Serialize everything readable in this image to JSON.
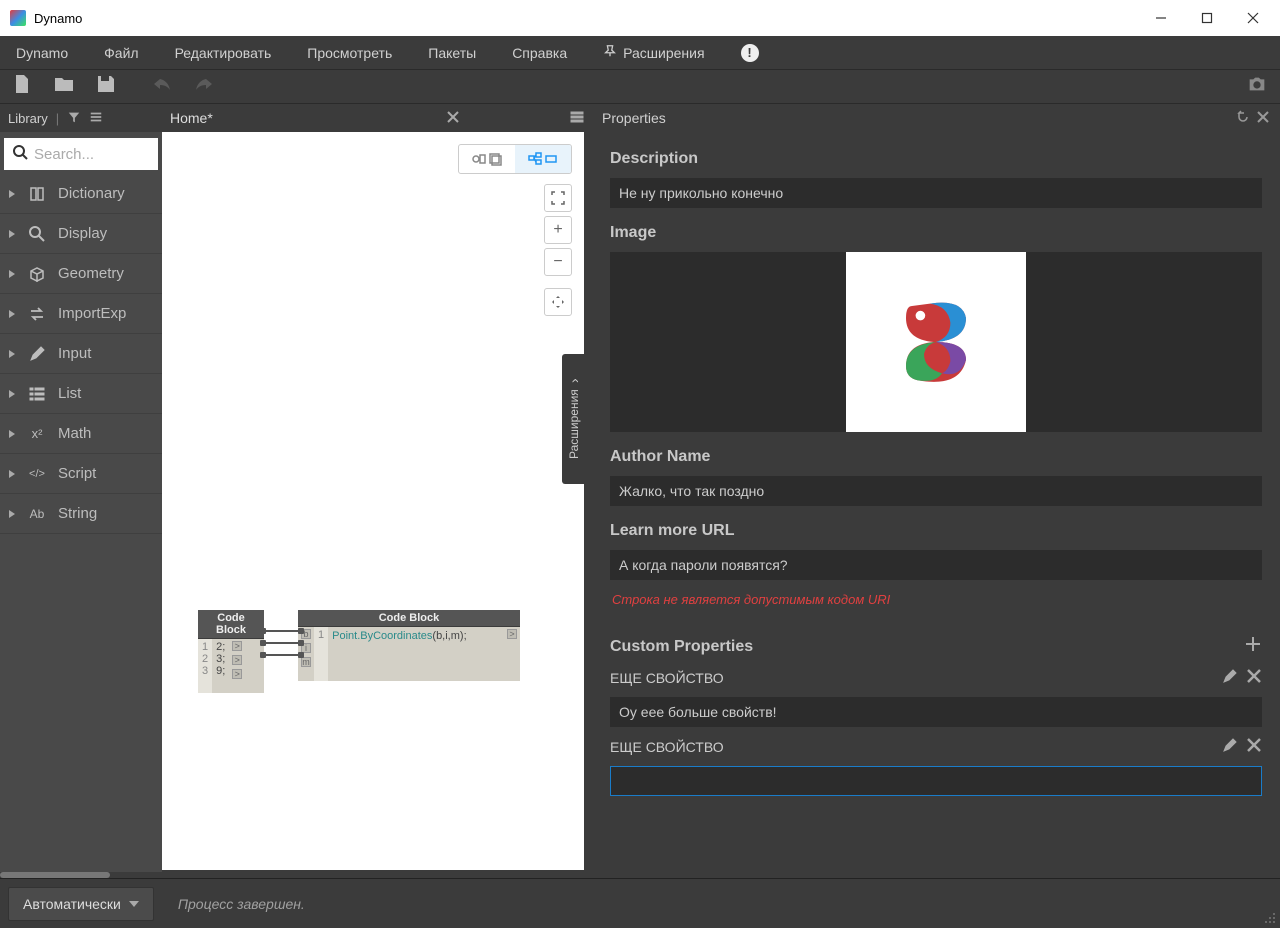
{
  "window": {
    "title": "Dynamo"
  },
  "menubar": {
    "items": [
      "Dynamo",
      "Файл",
      "Редактировать",
      "Просмотреть",
      "Пакеты",
      "Справка"
    ],
    "extensions": "Расширения",
    "info_badge": "!"
  },
  "library": {
    "title": "Library",
    "search_placeholder": "Search...",
    "items": [
      {
        "label": "Dictionary",
        "icon": "book-icon"
      },
      {
        "label": "Display",
        "icon": "search-icon"
      },
      {
        "label": "Geometry",
        "icon": "cube-icon"
      },
      {
        "label": "ImportExp",
        "icon": "swap-icon"
      },
      {
        "label": "Input",
        "icon": "pencil-icon"
      },
      {
        "label": "List",
        "icon": "list-icon"
      },
      {
        "label": "Math",
        "icon": "math-icon"
      },
      {
        "label": "Script",
        "icon": "code-icon"
      },
      {
        "label": "String",
        "icon": "text-icon"
      }
    ]
  },
  "workspace": {
    "tab_title": "Home*",
    "side_panel_label": "Расширения",
    "zoom": {
      "fit": "⛶",
      "plus": "+",
      "minus": "−",
      "pan": "✥"
    }
  },
  "nodes": {
    "n1": {
      "title": "Code Block",
      "lines": [
        {
          "n": "1",
          "code": "2;"
        },
        {
          "n": "2",
          "code": "3;"
        },
        {
          "n": "3",
          "code": "9;"
        }
      ],
      "outports": [
        ">",
        ">",
        ">"
      ]
    },
    "n2": {
      "title": "Code Block",
      "inports": [
        "b",
        "i",
        "m"
      ],
      "line_num": "1",
      "fn": "Point.ByCoordinates",
      "args": "(b,i,m);",
      "outports": [
        ">"
      ]
    }
  },
  "properties": {
    "panel_title": "Properties",
    "description_label": "Description",
    "description_value": "Не ну прикольно конечно",
    "image_label": "Image",
    "author_label": "Author Name",
    "author_value": "Жалко, что так поздно",
    "url_label": "Learn more URL",
    "url_value": "А когда пароли появятся?",
    "url_error": "Строка не является допустимым кодом URI",
    "custom_label": "Custom Properties",
    "rows": [
      {
        "name": "ЕЩЕ СВОЙСТВО",
        "value": "Оу еее больше свойств!"
      },
      {
        "name": "ЕЩЕ СВОЙСТВО",
        "value": ""
      }
    ]
  },
  "statusbar": {
    "run_mode": "Автоматически",
    "status": "Процесс завершен."
  }
}
